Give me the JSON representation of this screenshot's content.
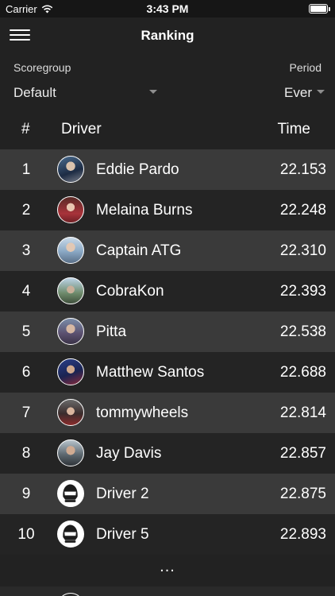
{
  "status_bar": {
    "carrier": "Carrier",
    "time": "3:43 PM"
  },
  "nav": {
    "title": "Ranking",
    "menu_icon": "hamburger-menu-icon"
  },
  "filters": {
    "scoregroup": {
      "label": "Scoregroup",
      "value": "Default"
    },
    "period": {
      "label": "Period",
      "value": "Ever"
    }
  },
  "table": {
    "headers": {
      "rank": "#",
      "driver": "Driver",
      "time": "Time"
    },
    "rows": [
      {
        "rank": "1",
        "driver": "Eddie Pardo",
        "time": "22.153",
        "avatar": "photo"
      },
      {
        "rank": "2",
        "driver": "Melaina Burns",
        "time": "22.248",
        "avatar": "photo"
      },
      {
        "rank": "3",
        "driver": "Captain ATG",
        "time": "22.310",
        "avatar": "photo"
      },
      {
        "rank": "4",
        "driver": "CobraKon",
        "time": "22.393",
        "avatar": "photo"
      },
      {
        "rank": "5",
        "driver": "Pitta",
        "time": "22.538",
        "avatar": "photo"
      },
      {
        "rank": "6",
        "driver": "Matthew Santos",
        "time": "22.688",
        "avatar": "photo"
      },
      {
        "rank": "7",
        "driver": "tommywheels",
        "time": "22.814",
        "avatar": "photo"
      },
      {
        "rank": "8",
        "driver": "Jay Davis",
        "time": "22.857",
        "avatar": "photo"
      },
      {
        "rank": "9",
        "driver": "Driver 2",
        "time": "22.875",
        "avatar": "helmet"
      },
      {
        "rank": "10",
        "driver": "Driver 5",
        "time": "22.893",
        "avatar": "helmet"
      }
    ],
    "more": "..."
  }
}
